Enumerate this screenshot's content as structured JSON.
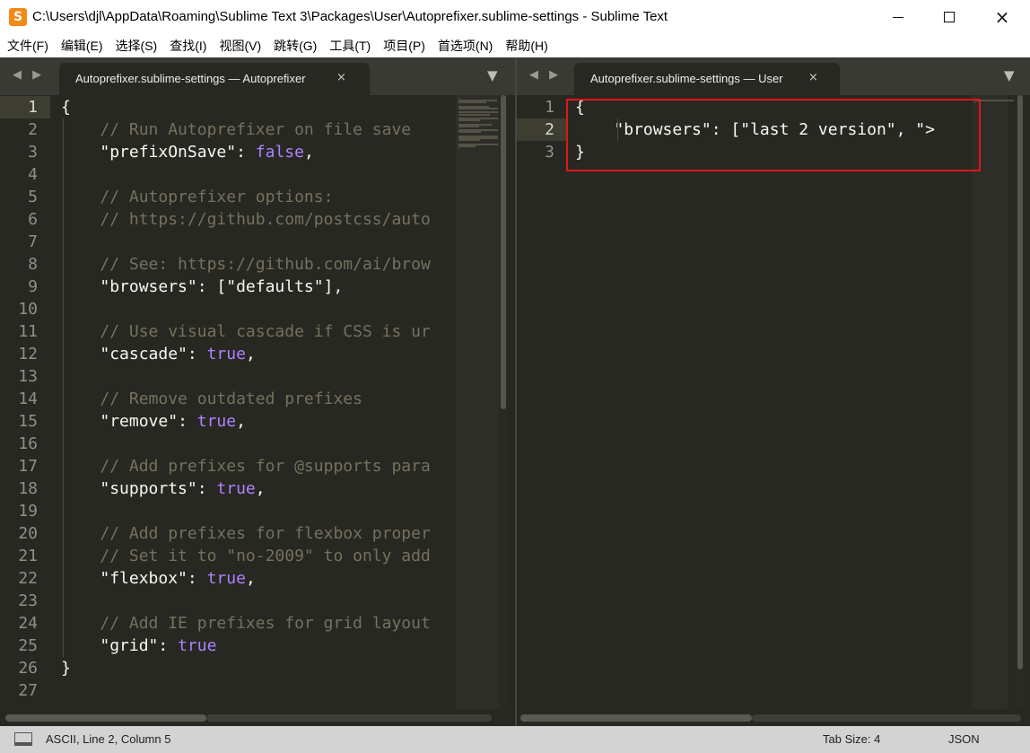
{
  "window": {
    "title": "C:\\Users\\djl\\AppData\\Roaming\\Sublime Text 3\\Packages\\User\\Autoprefixer.sublime-settings - Sublime Text",
    "app_icon": "sublime-text-icon",
    "minimize_icon": "minimize-icon",
    "maximize_icon": "maximize-icon",
    "close_icon": "close-icon"
  },
  "menu": [
    "文件(F)",
    "编辑(E)",
    "选择(S)",
    "查找(I)",
    "视图(V)",
    "跳转(G)",
    "工具(T)",
    "项目(P)",
    "首选项(N)",
    "帮助(H)"
  ],
  "left_pane": {
    "tab_label": "Autoprefixer.sublime-settings — Autoprefixer",
    "current_line": 1,
    "lines": [
      [
        [
          "{",
          "p"
        ]
      ],
      [
        [
          "    ",
          "p"
        ],
        [
          "// Run Autoprefixer on file save",
          "c"
        ]
      ],
      [
        [
          "    ",
          "p"
        ],
        [
          "\"prefixOnSave\"",
          "p"
        ],
        [
          ": ",
          "p"
        ],
        [
          "false",
          "k"
        ],
        [
          ",",
          "p"
        ]
      ],
      [],
      [
        [
          "    ",
          "p"
        ],
        [
          "// Autoprefixer options:",
          "c"
        ]
      ],
      [
        [
          "    ",
          "p"
        ],
        [
          "// https://github.com/postcss/auto",
          "c"
        ]
      ],
      [],
      [
        [
          "    ",
          "p"
        ],
        [
          "// See: https://github.com/ai/brow",
          "c"
        ]
      ],
      [
        [
          "    ",
          "p"
        ],
        [
          "\"browsers\": [\"defaults\"],",
          "p"
        ]
      ],
      [],
      [
        [
          "    ",
          "p"
        ],
        [
          "// Use visual cascade if CSS is ur",
          "c"
        ]
      ],
      [
        [
          "    ",
          "p"
        ],
        [
          "\"cascade\"",
          "p"
        ],
        [
          ": ",
          "p"
        ],
        [
          "true",
          "k"
        ],
        [
          ",",
          "p"
        ]
      ],
      [],
      [
        [
          "    ",
          "p"
        ],
        [
          "// Remove outdated prefixes",
          "c"
        ]
      ],
      [
        [
          "    ",
          "p"
        ],
        [
          "\"remove\"",
          "p"
        ],
        [
          ": ",
          "p"
        ],
        [
          "true",
          "k"
        ],
        [
          ",",
          "p"
        ]
      ],
      [],
      [
        [
          "    ",
          "p"
        ],
        [
          "// Add prefixes for @supports para",
          "c"
        ]
      ],
      [
        [
          "    ",
          "p"
        ],
        [
          "\"supports\"",
          "p"
        ],
        [
          ": ",
          "p"
        ],
        [
          "true",
          "k"
        ],
        [
          ",",
          "p"
        ]
      ],
      [],
      [
        [
          "    ",
          "p"
        ],
        [
          "// Add prefixes for flexbox proper",
          "c"
        ]
      ],
      [
        [
          "    ",
          "p"
        ],
        [
          "// Set it to \"no-2009\" to only add",
          "c"
        ]
      ],
      [
        [
          "    ",
          "p"
        ],
        [
          "\"flexbox\"",
          "p"
        ],
        [
          ": ",
          "p"
        ],
        [
          "true",
          "k"
        ],
        [
          ",",
          "p"
        ]
      ],
      [],
      [
        [
          "    ",
          "p"
        ],
        [
          "// Add IE prefixes for grid layout",
          "c"
        ]
      ],
      [
        [
          "    ",
          "p"
        ],
        [
          "\"grid\"",
          "p"
        ],
        [
          ": ",
          "p"
        ],
        [
          "true",
          "k"
        ]
      ],
      [
        [
          "}",
          "p"
        ]
      ],
      []
    ]
  },
  "right_pane": {
    "tab_label": "Autoprefixer.sublime-settings — User",
    "current_line": 2,
    "lines": [
      [
        [
          "{",
          "p"
        ]
      ],
      [
        [
          "    ",
          "p"
        ],
        [
          "\"browsers\": [\"last 2 version\", \">",
          "p"
        ]
      ],
      [
        [
          "}",
          "p"
        ]
      ]
    ]
  },
  "nav_arrows": "◀ ▶",
  "tab_close_glyph": "×",
  "tab_dropdown_glyph": "▼",
  "status": {
    "main": "ASCII, Line 2, Column 5",
    "tab_size": "Tab Size: 4",
    "syntax": "JSON"
  },
  "colors": {
    "background": "#272822",
    "comment": "#75715e",
    "constant": "#ae81ff",
    "text": "#f8f8f2",
    "highlight_box": "#e31515"
  }
}
